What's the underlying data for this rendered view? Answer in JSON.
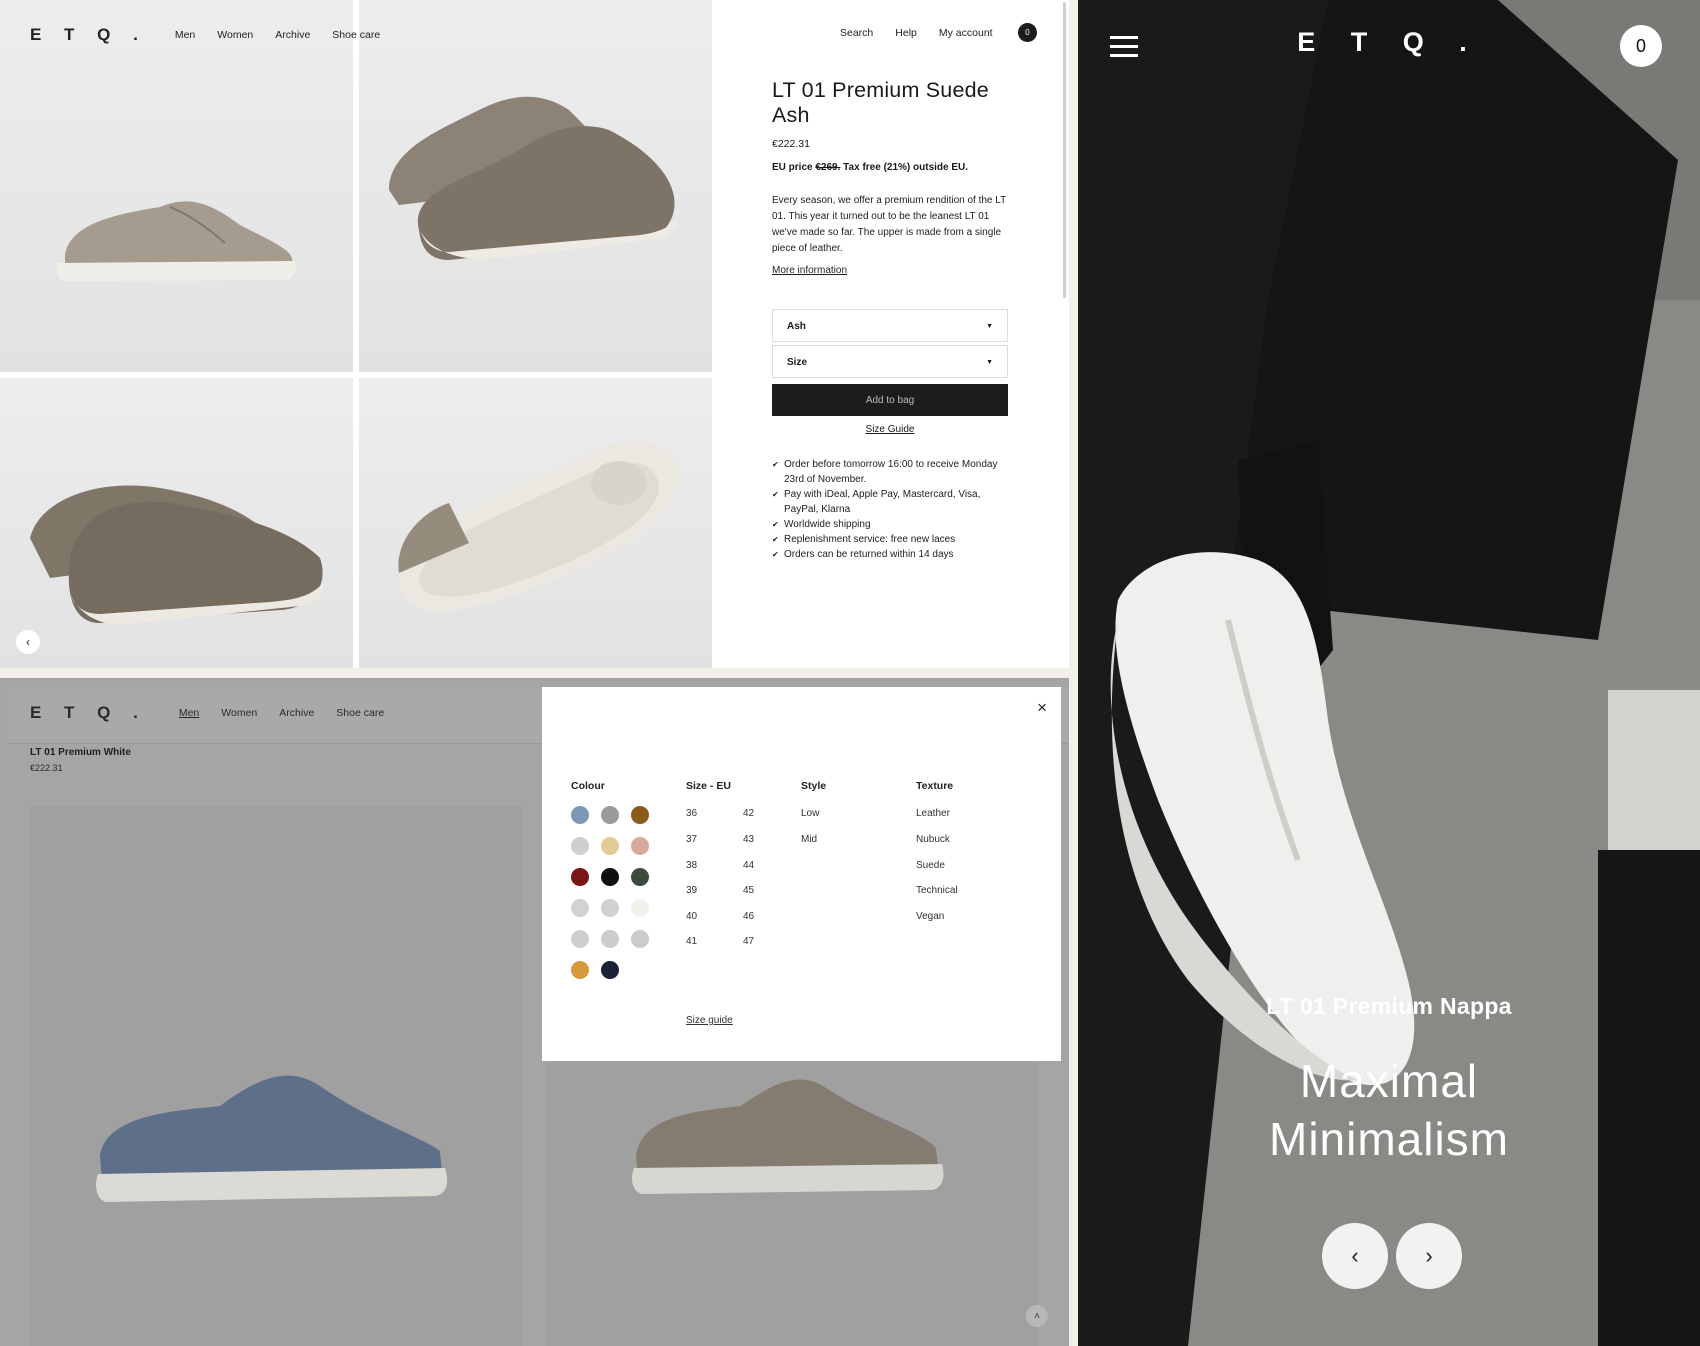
{
  "product_page": {
    "logo": "E T Q .",
    "nav": [
      "Men",
      "Women",
      "Archive",
      "Shoe care"
    ],
    "util_nav": [
      "Search",
      "Help",
      "My account"
    ],
    "cart_count": "0",
    "title": "LT 01 Premium Suede Ash",
    "price": "€222.31",
    "eu_label": "EU price",
    "eu_old_price": "€269.",
    "eu_note": "Tax free (21%) outside EU.",
    "description": "Every season, we offer a premium rendition of the LT 01. This year it turned out to be the leanest LT 01 we've made so far. The upper is made from a single piece of leather.",
    "more_info": "More information",
    "colour_select": "Ash",
    "size_select": "Size",
    "add_to_bag": "Add to bag",
    "size_guide": "Size Guide",
    "bullets": [
      "Order before tomorrow 16:00 to receive Monday 23rd of November.",
      "Pay with iDeal, Apple Pay, Mastercard, Visa, PayPal, Klarna",
      "Worldwide shipping",
      "Replenishment service: free new laces",
      "Orders can be returned within 14 days"
    ],
    "prev_icon": "‹"
  },
  "filter_page": {
    "logo": "E T Q .",
    "nav": [
      "Men",
      "Women",
      "Archive",
      "Shoe care"
    ],
    "product_name": "LT 01 Premium White",
    "product_price": "€222.31",
    "modal": {
      "close": "×",
      "colour_head": "Colour",
      "size_head": "Size - EU",
      "style_head": "Style",
      "texture_head": "Texture",
      "colours": [
        "#7d97b6",
        "#9b9b9b",
        "#8a5b1c",
        "#cfcfcf",
        "#e3cb97",
        "#dba89e",
        "#7a1518",
        "#0f0f0f",
        "#3d4a40",
        "#d2d2d2",
        "#d0d0d0",
        "#f1f0ea",
        "#cfcfcf",
        "#cdcdcd",
        "#cbcbcb",
        "#d69a3a",
        "#1b2238"
      ],
      "sizes_left": [
        "36",
        "37",
        "38",
        "39",
        "40",
        "41"
      ],
      "sizes_right": [
        "42",
        "43",
        "44",
        "45",
        "46",
        "47"
      ],
      "styles": [
        "Low",
        "Mid"
      ],
      "textures": [
        "Leather",
        "Nubuck",
        "Suede",
        "Technical",
        "Vegan"
      ],
      "size_guide": "Size guide"
    },
    "up_icon": "˄"
  },
  "hero": {
    "logo": "E T Q .",
    "cart_count": "0",
    "subtitle": "LT 01 Premium Nappa",
    "title_line1": "Maximal",
    "title_line2": "Minimalism",
    "prev": "‹",
    "next": "›"
  }
}
